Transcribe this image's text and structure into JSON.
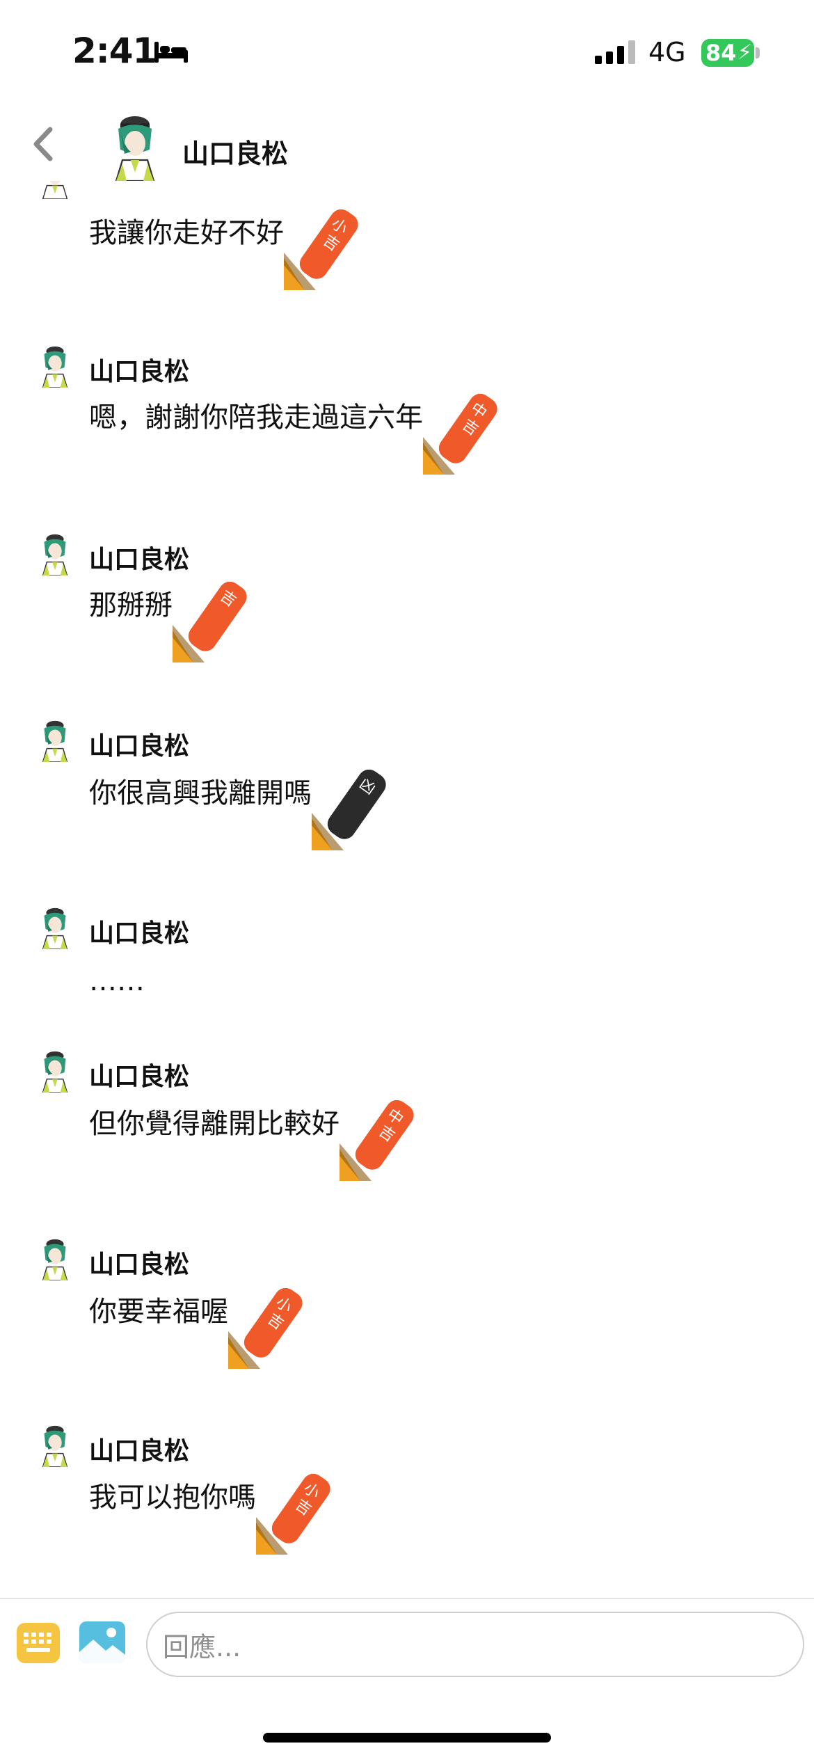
{
  "status_bar": {
    "time": "2:41",
    "network": "4G",
    "battery": "84"
  },
  "header": {
    "title": "山口良松"
  },
  "messages": [
    {
      "sender": "",
      "text": "我讓你走好不好",
      "stick_label": "小吉",
      "stick_color": "#f05a2a"
    },
    {
      "sender": "山口良松",
      "text": "嗯，謝謝你陪我走過這六年",
      "stick_label": "中吉",
      "stick_color": "#f05a2a"
    },
    {
      "sender": "山口良松",
      "text": "那掰掰",
      "stick_label": "吉",
      "stick_color": "#f05a2a"
    },
    {
      "sender": "山口良松",
      "text": "你很高興我離開嗎",
      "stick_label": "凶",
      "stick_color": "#2b2b2b"
    },
    {
      "sender": "山口良松",
      "text": "……",
      "stick_label": "",
      "stick_color": ""
    },
    {
      "sender": "山口良松",
      "text": "但你覺得離開比較好",
      "stick_label": "中吉",
      "stick_color": "#f05a2a"
    },
    {
      "sender": "山口良松",
      "text": "你要幸福喔",
      "stick_label": "小吉",
      "stick_color": "#f05a2a"
    },
    {
      "sender": "山口良松",
      "text": "我可以抱你嗎",
      "stick_label": "小吉",
      "stick_color": "#f05a2a"
    }
  ],
  "composer": {
    "placeholder": "回應..."
  },
  "colors": {
    "battery": "#34c759",
    "stick_orange": "#f05a2a",
    "stick_black": "#2b2b2b",
    "keyboard_icon": "#f5c542",
    "image_icon": "#56bfe0"
  }
}
